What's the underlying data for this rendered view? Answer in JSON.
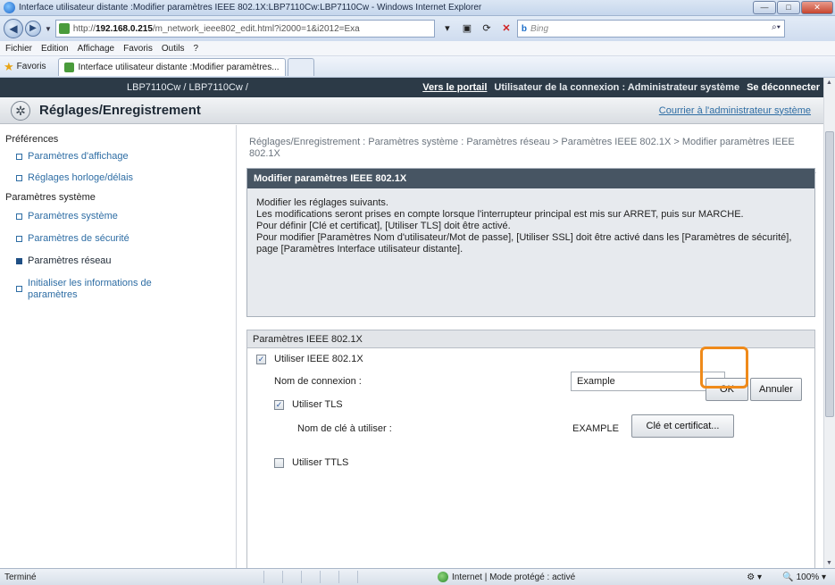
{
  "window": {
    "title": "Interface utilisateur distante :Modifier paramètres IEEE 802.1X:LBP7110Cw:LBP7110Cw - Windows Internet Explorer",
    "min": "—",
    "max": "□",
    "close": "✕"
  },
  "address": {
    "url_prefix": "http://",
    "url_host": "192.168.0.215",
    "url_rest": "/m_network_ieee802_edit.html?i2000=1&i2012=Exa",
    "search_placeholder": "Bing",
    "search_brand": "b"
  },
  "menu": [
    "Fichier",
    "Edition",
    "Affichage",
    "Favoris",
    "Outils",
    "?"
  ],
  "favorites": {
    "label": "Favoris",
    "tab_title": "Interface utilisateur distante :Modifier paramètres..."
  },
  "topbar": {
    "device": "LBP7110Cw / LBP7110Cw /",
    "portal": "Vers le portail",
    "user": "Utilisateur de la connexion : Administrateur système",
    "logout": "Se déconnecter"
  },
  "subhead": {
    "title": "Réglages/Enregistrement",
    "mail_admin": "Courrier à l'administrateur système"
  },
  "sidebar": {
    "group1": "Préférences",
    "g1_items": [
      "Paramètres d'affichage",
      "Réglages horloge/délais"
    ],
    "group2": "Paramètres système",
    "g2_items": [
      "Paramètres système",
      "Paramètres de sécurité",
      "Paramètres réseau",
      "Initialiser les informations de paramètres"
    ]
  },
  "breadcrumb": "Réglages/Enregistrement : Paramètres système : Paramètres réseau > Paramètres IEEE 802.1X > Modifier paramètres IEEE 802.1X",
  "panel": {
    "title": "Modifier paramètres IEEE 802.1X",
    "lines": [
      "Modifier les réglages suivants.",
      "Les modifications seront prises en compte lorsque l'interrupteur principal est mis sur ARRET, puis sur MARCHE.",
      "Pour définir [Clé et certificat], [Utiliser TLS] doit être activé.",
      "Pour modifier [Paramètres Nom d'utilisateur/Mot de passe], [Utiliser SSL] doit être activé dans les [Paramètres de sécurité], page [Paramètres Interface utilisateur distante]."
    ],
    "ok": "OK",
    "cancel": "Annuler"
  },
  "settings": {
    "header": "Paramètres IEEE 802.1X",
    "use_8021x": "Utiliser IEEE 802.1X",
    "login_name_label": "Nom de connexion :",
    "login_name_value": "Example",
    "use_tls": "Utiliser TLS",
    "key_name_label": "Nom de clé à utiliser :",
    "key_name_value": "EXAMPLE",
    "key_button": "Clé et certificat...",
    "use_ttls": "Utiliser TTLS"
  },
  "status": {
    "left": "Terminé",
    "zone": "Internet | Mode protégé : activé",
    "zoom": "100%"
  }
}
